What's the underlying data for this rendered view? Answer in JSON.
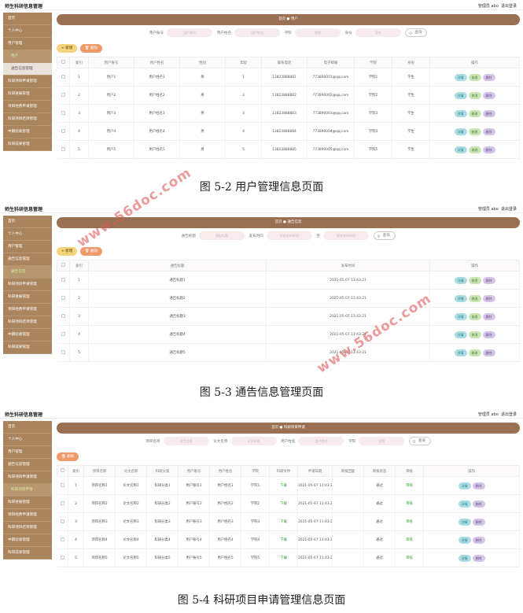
{
  "brand": "师生科研信息管理",
  "user": "管理员 abo",
  "logout": "退出登录",
  "s1": {
    "menu": [
      "首页",
      "个人中心",
      "用户管理",
      "用户",
      "通告信息管理",
      "科研项目申请管理",
      "科研进展管理",
      "项目经费申请管理",
      "科研项目结项管理",
      "中期验收管理",
      "科研成果管理"
    ],
    "bc": [
      "首页",
      "用户"
    ],
    "search": {
      "l1": "用户账号",
      "p1": "用户账号",
      "l2": "用户姓名",
      "p2": "用户姓名",
      "l3": "学院",
      "p3": "学院",
      "l4": "身份",
      "p4": "身份",
      "btn": "查询"
    },
    "add": "+ 新增",
    "del": "删除",
    "cols": [
      "",
      "索引",
      "用户账号",
      "用户姓名",
      "性别",
      "年龄",
      "联系电话",
      "电子邮箱",
      "学院",
      "身份",
      "操作"
    ],
    "rows": [
      [
        "1",
        "用户1",
        "用户姓名1",
        "男",
        "1",
        "13823888881",
        "773890001@qq.com",
        "学院1",
        "学生"
      ],
      [
        "2",
        "用户2",
        "用户姓名2",
        "男",
        "2",
        "13823888882",
        "773890002@qq.com",
        "学院2",
        "学生"
      ],
      [
        "3",
        "用户3",
        "用户姓名3",
        "男",
        "3",
        "13823888883",
        "773890003@qq.com",
        "学院3",
        "学生"
      ],
      [
        "4",
        "用户4",
        "用户姓名4",
        "男",
        "4",
        "13823888884",
        "773890004@qq.com",
        "学院4",
        "学生"
      ],
      [
        "5",
        "用户5",
        "用户姓名5",
        "男",
        "5",
        "13823888885",
        "773890005@qq.com",
        "学院5",
        "学生"
      ]
    ],
    "ops": [
      "详情",
      "修改",
      "删除"
    ],
    "caption": "图 5-2 用户管理信息页面"
  },
  "s2": {
    "menu": [
      "首页",
      "个人中心",
      "用户管理",
      "通告信息管理",
      "通告信息",
      "科研项目申请管理",
      "科研进展管理",
      "项目经费申请管理",
      "科研项目结项管理",
      "中期验收管理",
      "科研成果管理"
    ],
    "bc": [
      "首页",
      "通告信息"
    ],
    "search": {
      "l1": "通告标题",
      "p1": "通告标题",
      "l2": "发布时间",
      "p2": "开始发布时间",
      "mid": "至",
      "p3": "结束发布时间",
      "btn": "查询"
    },
    "add": "+ 新增",
    "del": "删除",
    "cols": [
      "",
      "索引",
      "通告标题",
      "发布时间",
      "操作"
    ],
    "rows": [
      [
        "1",
        "通告标题1",
        "2021-05-07 11:43:21"
      ],
      [
        "2",
        "通告标题2",
        "2021-05-07 11:43:21"
      ],
      [
        "3",
        "通告标题3",
        "2021-05-07 11:43:21"
      ],
      [
        "4",
        "通告标题4",
        "2021-05-07 11:43:21"
      ],
      [
        "5",
        "通告标题5",
        "2021-05-07 11:43:21"
      ]
    ],
    "ops": [
      "详情",
      "修改",
      "删除"
    ],
    "caption": "图 5-3 通告信息管理页面"
  },
  "s3": {
    "menu": [
      "首页",
      "个人中心",
      "用户管理",
      "通告信息管理",
      "科研项目申请管理",
      "科研项目申请",
      "科研进展管理",
      "项目经费申请管理",
      "科研项目结项管理",
      "中期验收管理",
      "科研成果管理"
    ],
    "bc": [
      "首页",
      "科研项目申请"
    ],
    "search": {
      "l1": "项目名称",
      "p1": "项目名称",
      "l2": "论文名称",
      "p2": "论文名称",
      "l3": "用户姓名",
      "p3": "用户姓名",
      "l4": "学院",
      "p4": "学院",
      "btn": "查询"
    },
    "del": "删除",
    "cols": [
      "",
      "索引",
      "项目名称",
      "论文名称",
      "科研分类",
      "用户账号",
      "用户姓名",
      "学院",
      "科研文件",
      "申请日期",
      "审核回复",
      "审核状态",
      "审核",
      "操作"
    ],
    "rows": [
      [
        "1",
        "项目名称1",
        "论文名称1",
        "科研分类1",
        "用户账号1",
        "用户姓名1",
        "学院1",
        "下载",
        "2021-05-07 11:43:21",
        "",
        "通过",
        "审核"
      ],
      [
        "2",
        "项目名称2",
        "论文名称2",
        "科研分类2",
        "用户账号2",
        "用户姓名2",
        "学院2",
        "下载",
        "2021-05-07 11:43:21",
        "",
        "通过",
        "审核"
      ],
      [
        "3",
        "项目名称3",
        "论文名称3",
        "科研分类3",
        "用户账号3",
        "用户姓名3",
        "学院3",
        "下载",
        "2021-05-07 11:43:21",
        "",
        "通过",
        "审核"
      ],
      [
        "4",
        "项目名称4",
        "论文名称4",
        "科研分类4",
        "用户账号4",
        "用户姓名4",
        "学院4",
        "下载",
        "2021-05-07 11:43:21",
        "",
        "通过",
        "审核"
      ],
      [
        "5",
        "项目名称5",
        "论文名称5",
        "科研分类5",
        "用户账号5",
        "用户姓名5",
        "学院5",
        "下载",
        "2021-05-07 11:43:21",
        "",
        "通过",
        "审核"
      ]
    ],
    "ops": [
      "详情",
      "删除"
    ],
    "caption": "图 5-4 科研项目申请管理信息页面"
  },
  "watermark": "www.56doc.com"
}
